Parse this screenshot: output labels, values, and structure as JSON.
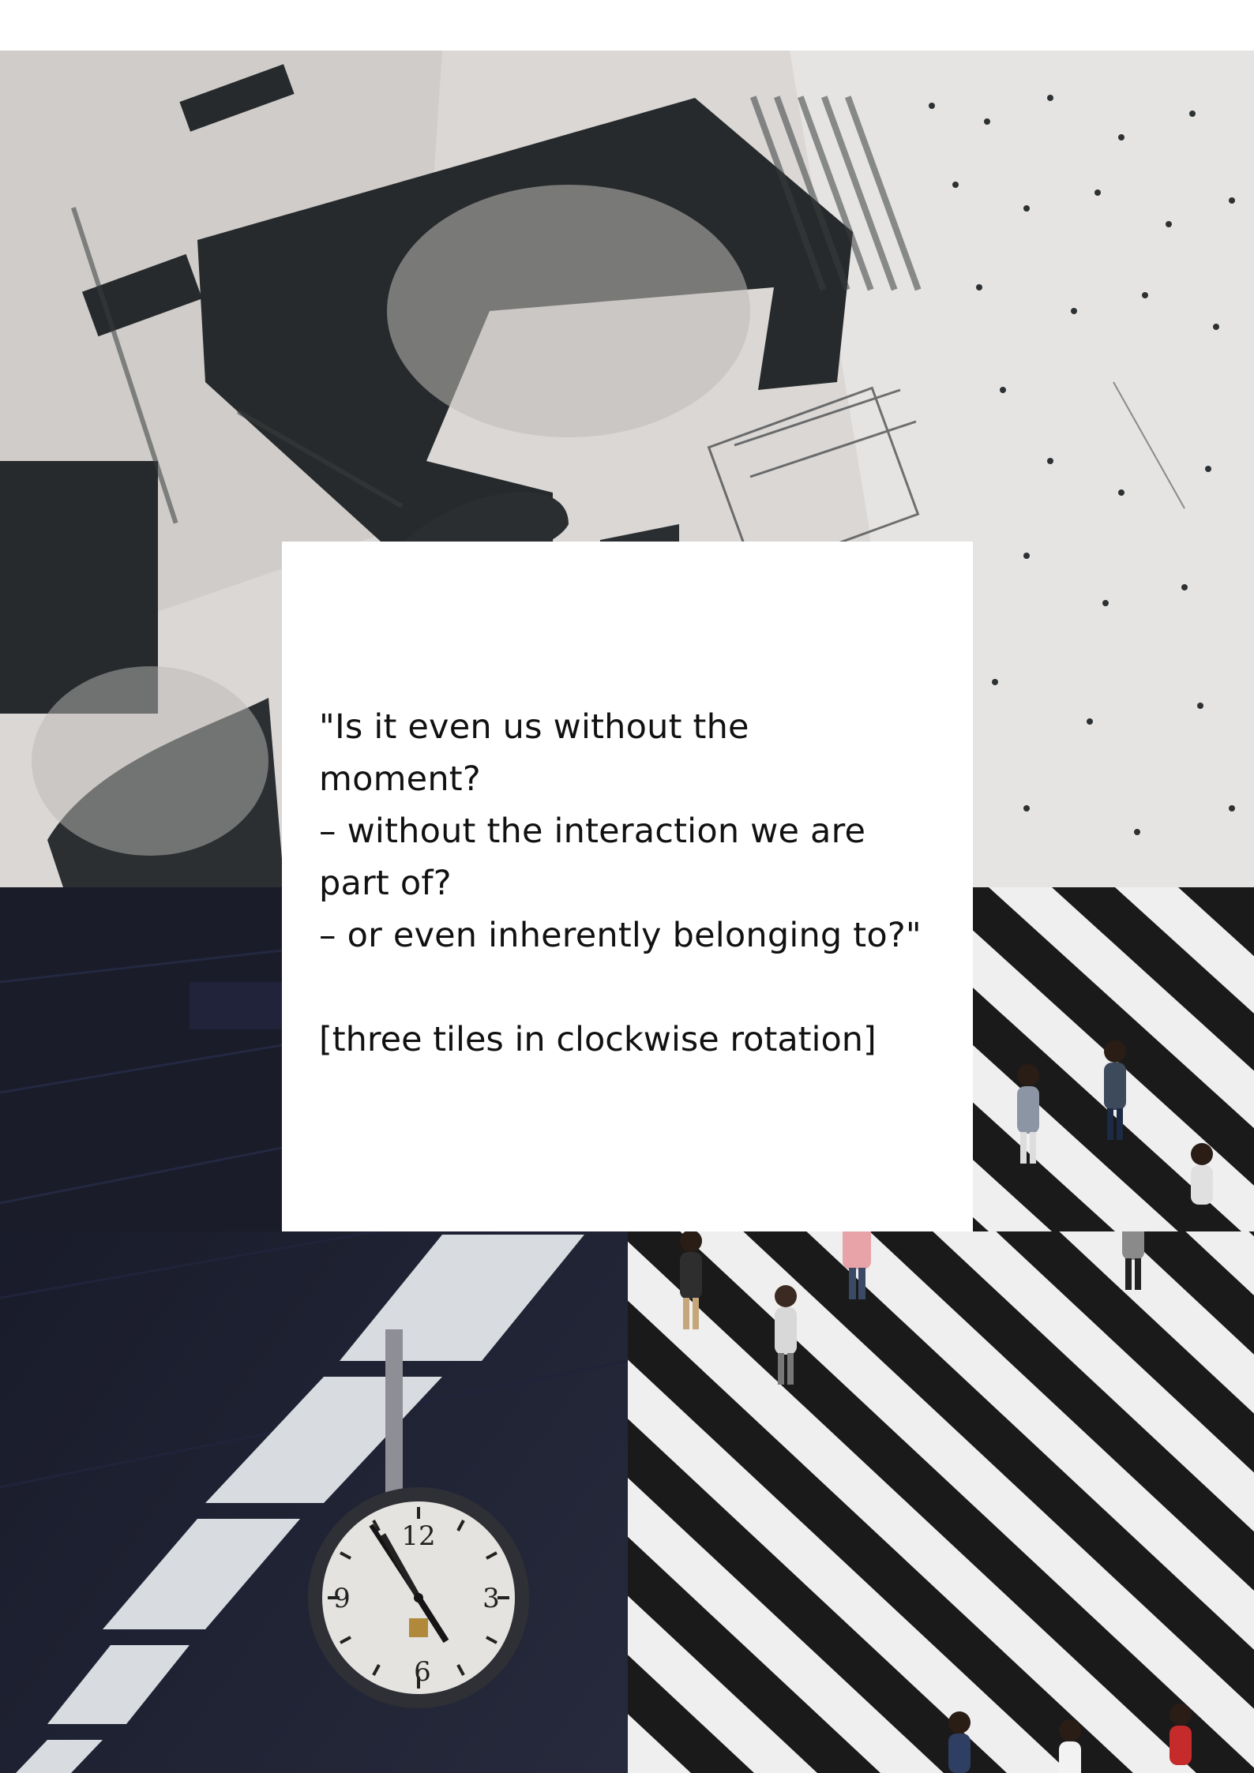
{
  "newspaper_photo": {
    "icon": "newspaper-collage-photo",
    "colors": {
      "paper": "#d9d6d4",
      "ink": "#262a2c"
    }
  },
  "clock_photo": {
    "icon": "station-clock-photo",
    "dial_numbers": [
      "12",
      "3",
      "6",
      "9"
    ],
    "colors": {
      "ceiling": "#1c1e2d",
      "face": "#e4e3df"
    }
  },
  "crossing_photo": {
    "icon": "pedestrian-crossing-photo",
    "colors": {
      "stripe_dark": "#1a1a1a",
      "stripe_light": "#f0f0f0"
    }
  },
  "quote": {
    "lines": [
      "\"Is it even us without the",
      "moment?",
      "– without the interaction we are",
      "part of?",
      "– or even inherently belonging to?\""
    ],
    "note": "[three tiles in clockwise rotation]"
  }
}
